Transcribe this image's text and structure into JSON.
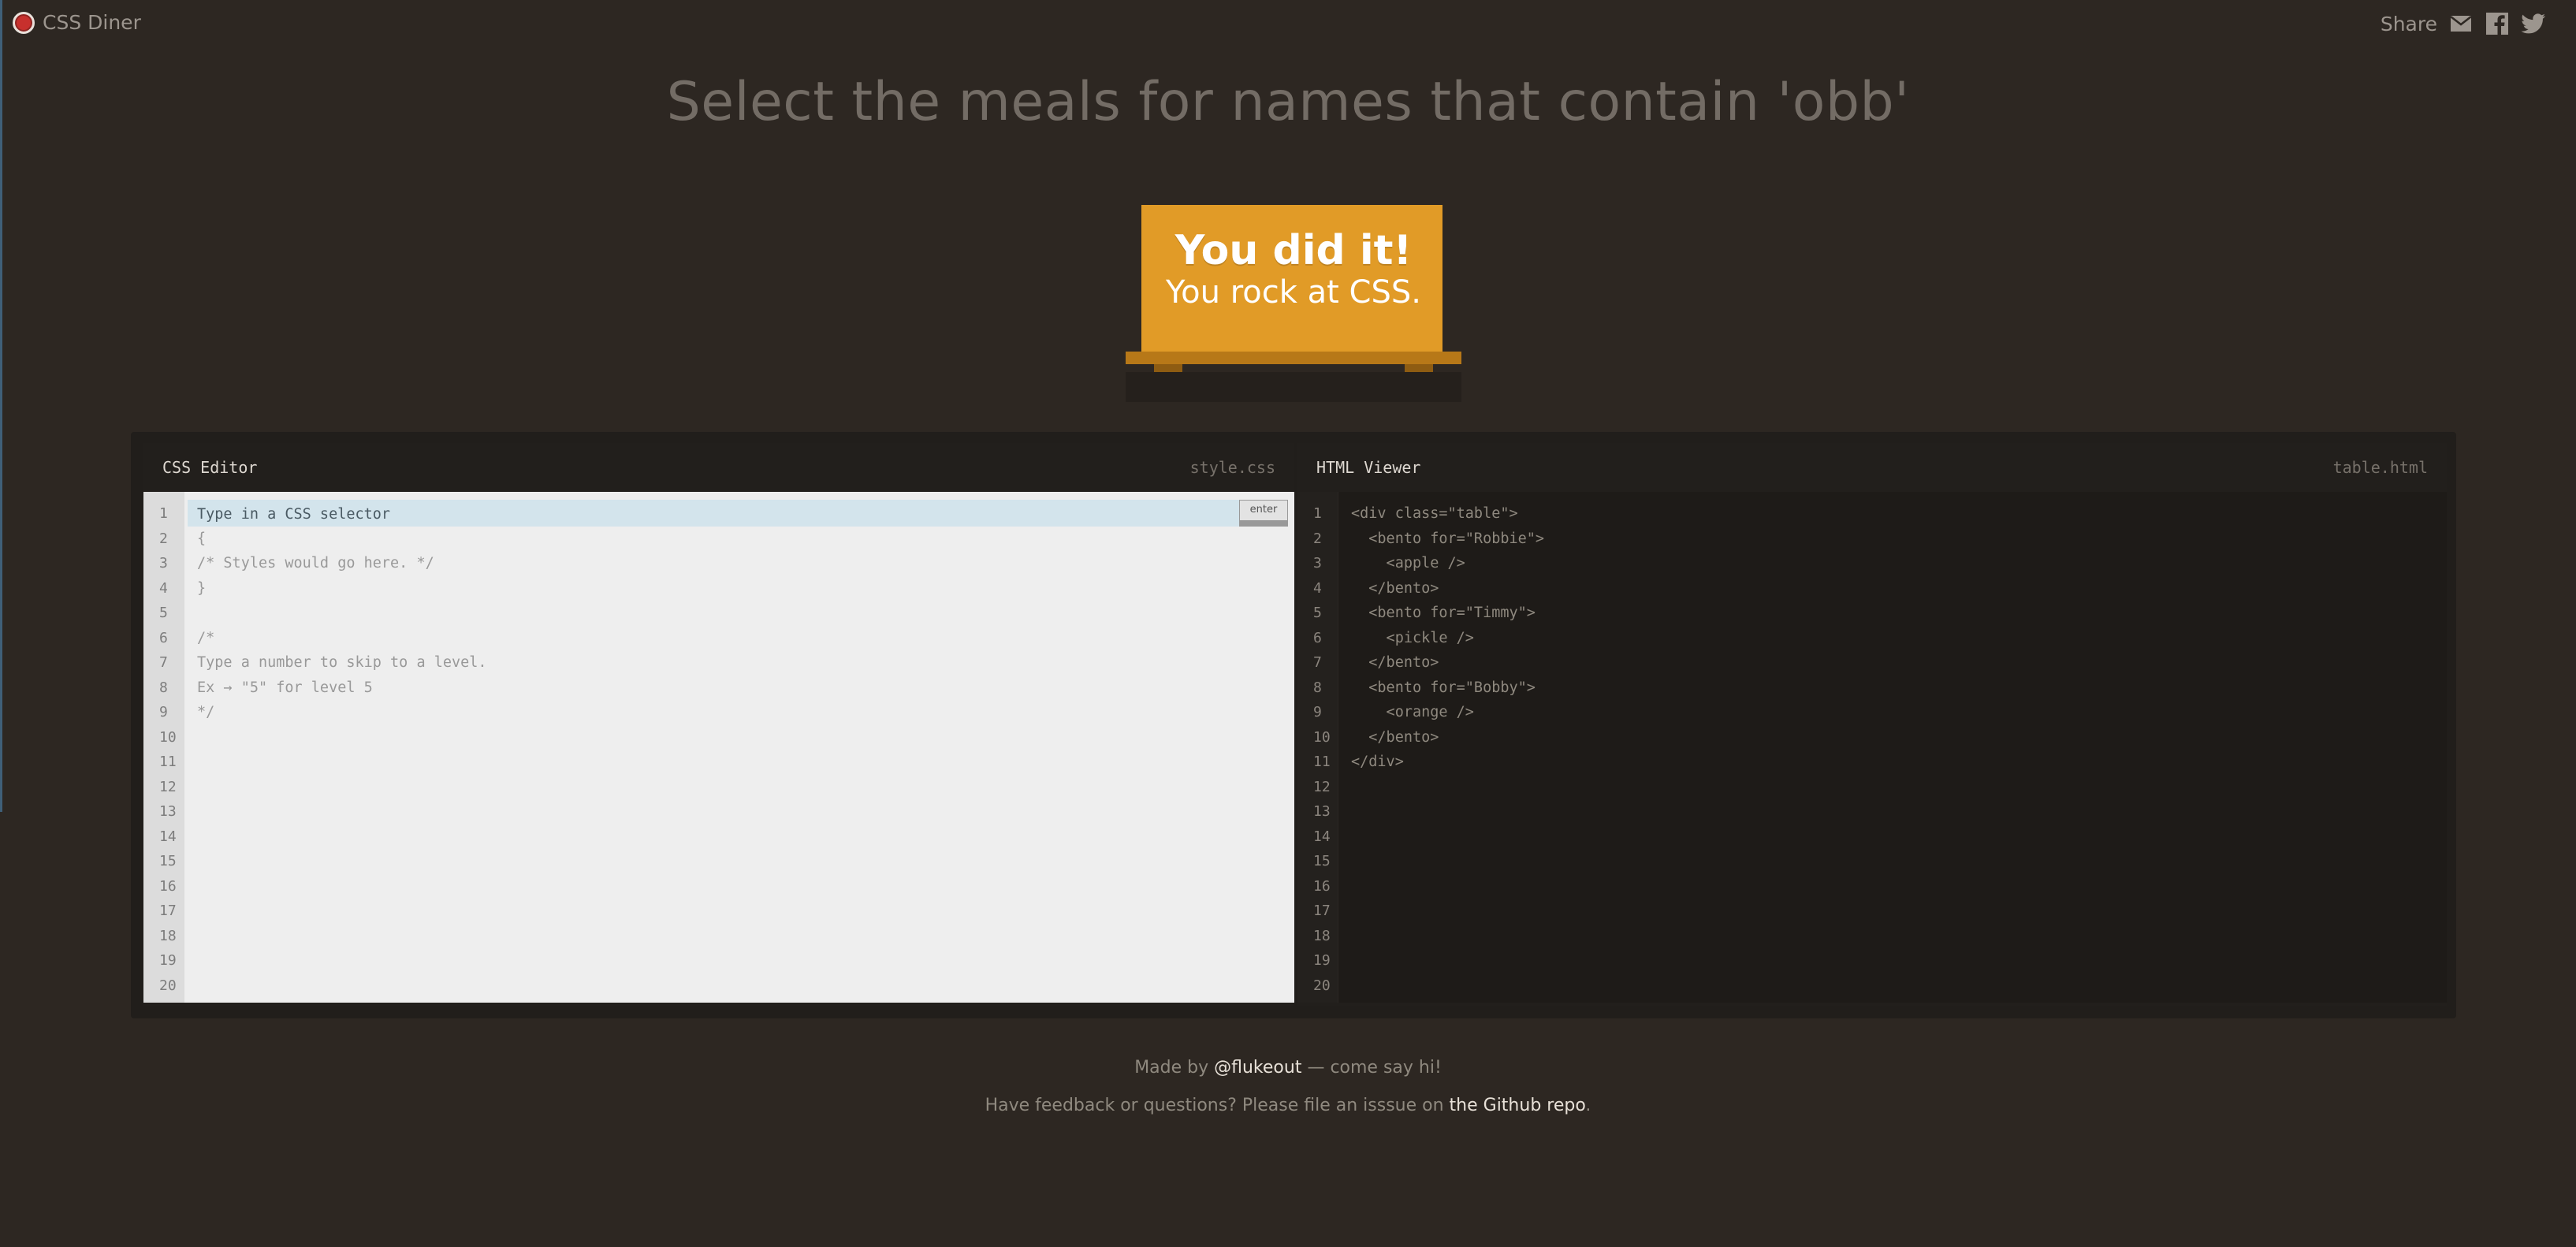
{
  "app": {
    "name": "CSS Diner",
    "logo_icon": "restaurant-logo-icon"
  },
  "header": {
    "share_label": "Share",
    "share_icons": [
      "email-icon",
      "facebook-icon",
      "twitter-icon"
    ]
  },
  "level": {
    "instruction": "Select the meals for names that contain 'obb'"
  },
  "result": {
    "line1": "You did it!",
    "line2": "You rock at CSS."
  },
  "css_editor": {
    "title": "CSS Editor",
    "filename": "style.css",
    "placeholder": "Type in a CSS selector",
    "input_value": "",
    "enter_label": "enter",
    "lines": [
      "{",
      "/* Styles would go here. */",
      "}",
      "",
      "/*",
      "Type a number to skip to a level.",
      "Ex → \"5\" for level 5",
      "*/"
    ]
  },
  "html_viewer": {
    "title": "HTML Viewer",
    "filename": "table.html",
    "lines": [
      "<div class=\"table\">",
      "  <bento for=\"Robbie\">",
      "    <apple />",
      "  </bento>",
      "  <bento for=\"Timmy\">",
      "    <pickle />",
      "  </bento>",
      "  <bento for=\"Bobby\">",
      "    <orange />",
      "  </bento>",
      "</div>"
    ]
  },
  "line_numbers": [
    "1",
    "2",
    "3",
    "4",
    "5",
    "6",
    "7",
    "8",
    "9",
    "10",
    "11",
    "12",
    "13",
    "14",
    "15",
    "16",
    "17",
    "18",
    "19",
    "20"
  ],
  "footer": {
    "made_by_prefix": "Made by ",
    "author_link": "@flukeout",
    "made_by_suffix": " — come say hi!",
    "feedback_prefix": "Have feedback or questions? Please file an isssue on ",
    "repo_link": "the Github repo",
    "feedback_suffix": "."
  },
  "colors": {
    "background": "#2d2722",
    "table_orange": "#e19b27",
    "input_highlight": "#d3e4ec"
  }
}
